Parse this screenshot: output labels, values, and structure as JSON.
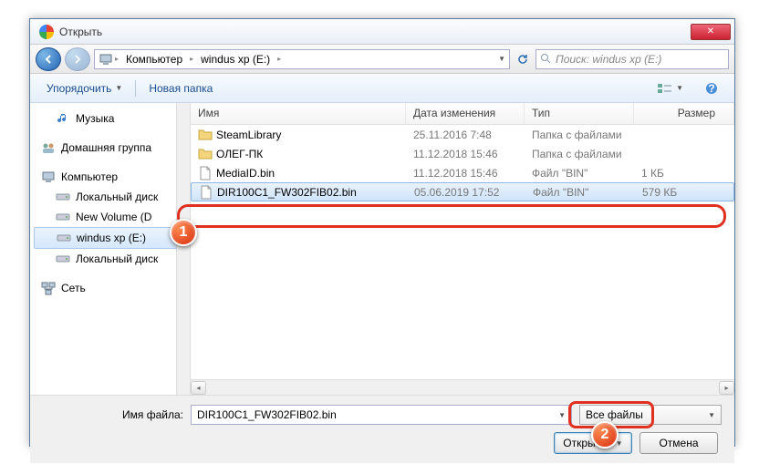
{
  "window": {
    "title": "Открыть"
  },
  "breadcrumb": {
    "items": [
      "Компьютер",
      "windus xp (E:)"
    ]
  },
  "search": {
    "placeholder": "Поиск: windus xp (E:)"
  },
  "toolbar": {
    "organize": "Упорядочить",
    "new_folder": "Новая папка"
  },
  "nav": {
    "music": "Музыка",
    "homegroup": "Домашняя группа",
    "computer": "Компьютер",
    "local1": "Локальный диск",
    "newvol": "New Volume (D",
    "windus": "windus xp (E:)",
    "local2": "Локальный диск",
    "network": "Сеть"
  },
  "columns": {
    "name": "Имя",
    "date": "Дата изменения",
    "type": "Тип",
    "size": "Размер"
  },
  "rows": [
    {
      "name": "SteamLibrary",
      "date": "25.11.2016 7:48",
      "type": "Папка с файлами",
      "size": "",
      "kind": "folder"
    },
    {
      "name": "ОЛЕГ-ПК",
      "date": "11.12.2018 15:46",
      "type": "Папка с файлами",
      "size": "",
      "kind": "folder"
    },
    {
      "name": "MediaID.bin",
      "date": "11.12.2018 15:46",
      "type": "Файл \"BIN\"",
      "size": "1 КБ",
      "kind": "file"
    },
    {
      "name": "DIR100C1_FW302FIB02.bin",
      "date": "05.06.2019 17:52",
      "type": "Файл \"BIN\"",
      "size": "579 КБ",
      "kind": "file",
      "selected": true
    }
  ],
  "footer": {
    "filename_label": "Имя файла:",
    "filename_value": "DIR100C1_FW302FIB02.bin",
    "filter": "Все файлы",
    "open": "Открыть",
    "cancel": "Отмена"
  },
  "markers": {
    "m1": "1",
    "m2": "2"
  }
}
